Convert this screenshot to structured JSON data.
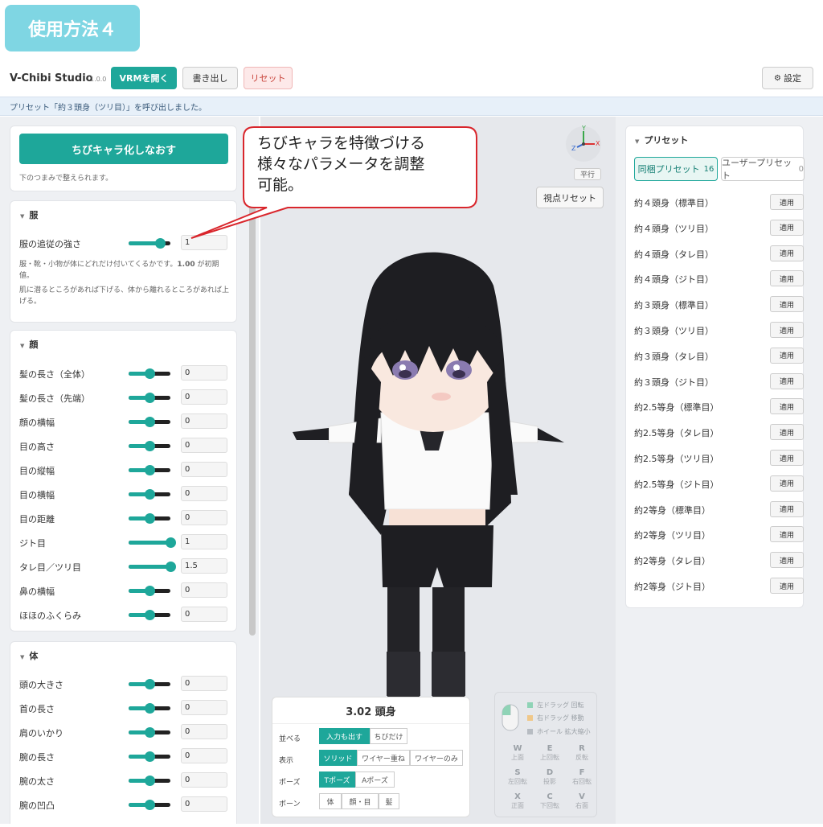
{
  "title_badge": "使用方法４",
  "app": {
    "name": "V-Chibi Studio",
    "version": "1.0.0",
    "open_vrm_label": "VRMを開く",
    "export_label": "書き出し",
    "reset_label": "リセット",
    "settings_label": "設定",
    "settings_icon": "gear-icon"
  },
  "status_message": "プリセット「約３頭身（ツリ目）」を呼び出しました。",
  "left": {
    "rechibi_label": "ちびキャラ化しなおす",
    "rechibi_note": "下のつまみで整えられます。",
    "clothes": {
      "title": "服",
      "rows": [
        {
          "label": "服の追従の強さ",
          "value": "1",
          "level": 0.75
        }
      ],
      "desc1": "服・靴・小物が体にどれだけ付いてくるかです。",
      "desc1_bold": "1.00",
      "desc1_tail": " が初期値。",
      "desc2": "肌に潜るところがあれば下げる、体から離れるところがあれば上げる。"
    },
    "face": {
      "title": "顔",
      "rows": [
        {
          "label": "髪の長さ（全体）",
          "value": "0",
          "level": 0.5
        },
        {
          "label": "髪の長さ（先端）",
          "value": "0",
          "level": 0.5
        },
        {
          "label": "顔の横幅",
          "value": "0",
          "level": 0.5
        },
        {
          "label": "目の高さ",
          "value": "0",
          "level": 0.5
        },
        {
          "label": "目の縦幅",
          "value": "0",
          "level": 0.5
        },
        {
          "label": "目の横幅",
          "value": "0",
          "level": 0.5
        },
        {
          "label": "目の距離",
          "value": "0",
          "level": 0.5
        },
        {
          "label": "ジト目",
          "value": "1",
          "level": 1.0
        },
        {
          "label": "タレ目／ツリ目",
          "value": "1.5",
          "level": 1.0
        },
        {
          "label": "鼻の横幅",
          "value": "0",
          "level": 0.5
        },
        {
          "label": "ほほのふくらみ",
          "value": "0",
          "level": 0.5
        }
      ]
    },
    "body": {
      "title": "体",
      "rows": [
        {
          "label": "頭の大きさ",
          "value": "0",
          "level": 0.5
        },
        {
          "label": "首の長さ",
          "value": "0",
          "level": 0.5
        },
        {
          "label": "肩のいかり",
          "value": "0",
          "level": 0.5
        },
        {
          "label": "腕の長さ",
          "value": "0",
          "level": 0.5
        },
        {
          "label": "腕の太さ",
          "value": "0",
          "level": 0.5
        },
        {
          "label": "腕の凹凸",
          "value": "0",
          "level": 0.5
        }
      ]
    }
  },
  "callout": {
    "line1": "ちびキャラを特徴づける",
    "line2": "様々なパラメータを調整",
    "line3": "可能。"
  },
  "viewport": {
    "ortho_label": "平行",
    "view_reset_label": "視点リセット",
    "axis_y": "Y",
    "axis_x": "X",
    "axis_z": "Z",
    "ratio": "3.02 頭身",
    "arrange_label": "並べる",
    "arrange_opts": [
      "入力も出す",
      "ちびだけ"
    ],
    "display_label": "表示",
    "display_opts": [
      "ソリッド",
      "ワイヤー重ね",
      "ワイヤーのみ"
    ],
    "pose_label": "ポーズ",
    "pose_opts": [
      "Tポーズ",
      "Aポーズ"
    ],
    "bone_label": "ボーン",
    "bone_opts": [
      "体",
      "顔・目",
      "髪"
    ]
  },
  "help": {
    "drag_left": "左ドラッグ 回転",
    "drag_right": "右ドラッグ 移動",
    "wheel": "ホイール 拡大縮小",
    "colors": {
      "left": "#8fd3b6",
      "right": "#f0c88a",
      "wheel": "#b7bcc2"
    },
    "keys": [
      {
        "k": "W",
        "d": "上面"
      },
      {
        "k": "E",
        "d": "上回転"
      },
      {
        "k": "R",
        "d": "反転"
      },
      {
        "k": "S",
        "d": "左回転"
      },
      {
        "k": "D",
        "d": "投影"
      },
      {
        "k": "F",
        "d": "右回転"
      },
      {
        "k": "X",
        "d": "正面"
      },
      {
        "k": "C",
        "d": "下回転"
      },
      {
        "k": "V",
        "d": "右面"
      }
    ]
  },
  "presets": {
    "title": "プリセット",
    "tab_bundled": "同梱プリセット",
    "tab_bundled_count": "16",
    "tab_user": "ユーザープリセット",
    "tab_user_count": "0",
    "apply_label": "適用",
    "items": [
      "約４頭身（標準目）",
      "約４頭身（ツリ目）",
      "約４頭身（タレ目）",
      "約４頭身（ジト目）",
      "約３頭身（標準目）",
      "約３頭身（ツリ目）",
      "約３頭身（タレ目）",
      "約３頭身（ジト目）",
      "約2.5等身（標準目）",
      "約2.5等身（タレ目）",
      "約2.5等身（ツリ目）",
      "約2.5等身（ジト目）",
      "約2等身（標準目）",
      "約2等身（ツリ目）",
      "約2等身（タレ目）",
      "約2等身（ジト目）"
    ]
  },
  "colors": {
    "accent": "#1ea79a",
    "callout_border": "#d9262c"
  }
}
